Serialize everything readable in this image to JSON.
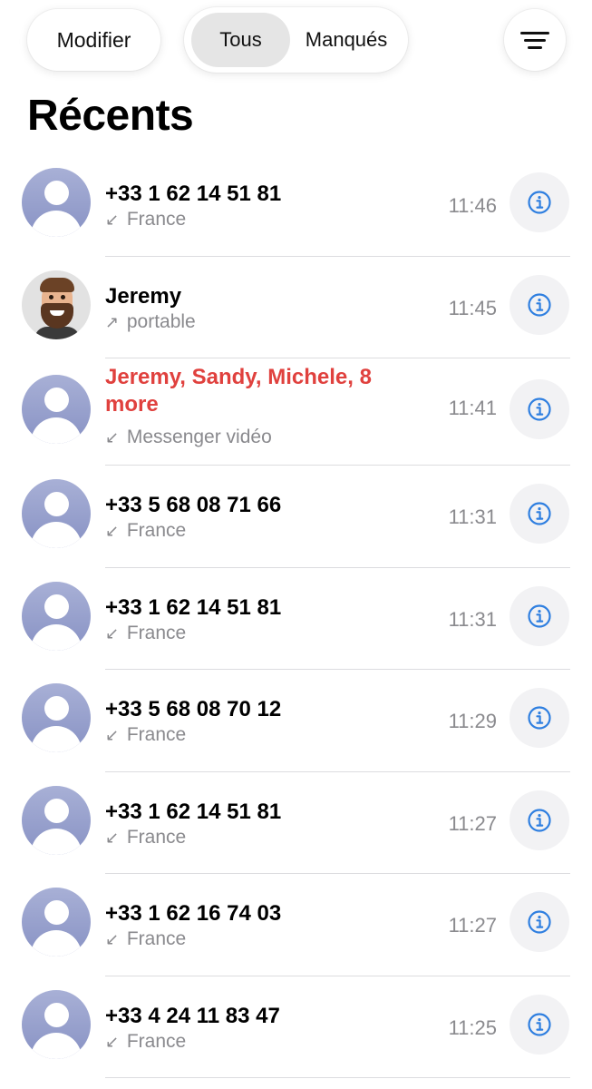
{
  "header": {
    "edit_label": "Modifier",
    "segments": [
      "Tous",
      "Manqués"
    ],
    "selected_segment": "Tous",
    "filter_icon": "filter-lines-icon",
    "title": "Récents"
  },
  "colors": {
    "missed": "#e0413e",
    "info_icon": "#2f7fe0",
    "secondary_text": "#8a8a8e"
  },
  "calls": [
    {
      "name": "+33 1 62 14 51 81",
      "direction_icon": "↙",
      "subtitle": "France",
      "time": "11:46",
      "missed": false,
      "avatar": "placeholder"
    },
    {
      "name": "Jeremy",
      "direction_icon": "↗",
      "subtitle": "portable",
      "time": "11:45",
      "missed": false,
      "avatar": "memoji"
    },
    {
      "name": "Jeremy, Sandy, Michele, 8 more",
      "direction_icon": "↙",
      "subtitle": "Messenger vidéo",
      "time": "11:41",
      "missed": true,
      "avatar": "placeholder"
    },
    {
      "name": "+33 5 68 08 71 66",
      "direction_icon": "↙",
      "subtitle": "France",
      "time": "11:31",
      "missed": false,
      "avatar": "placeholder"
    },
    {
      "name": "+33 1 62 14 51 81",
      "direction_icon": "↙",
      "subtitle": "France",
      "time": "11:31",
      "missed": false,
      "avatar": "placeholder"
    },
    {
      "name": "+33 5 68 08 70 12",
      "direction_icon": "↙",
      "subtitle": "France",
      "time": "11:29",
      "missed": false,
      "avatar": "placeholder"
    },
    {
      "name": "+33 1 62 14 51 81",
      "direction_icon": "↙",
      "subtitle": "France",
      "time": "11:27",
      "missed": false,
      "avatar": "placeholder"
    },
    {
      "name": "+33 1 62 16 74 03",
      "direction_icon": "↙",
      "subtitle": "France",
      "time": "11:27",
      "missed": false,
      "avatar": "placeholder"
    },
    {
      "name": "+33 4 24 11 83 47",
      "direction_icon": "↙",
      "subtitle": "France",
      "time": "11:25",
      "missed": false,
      "avatar": "placeholder"
    }
  ]
}
